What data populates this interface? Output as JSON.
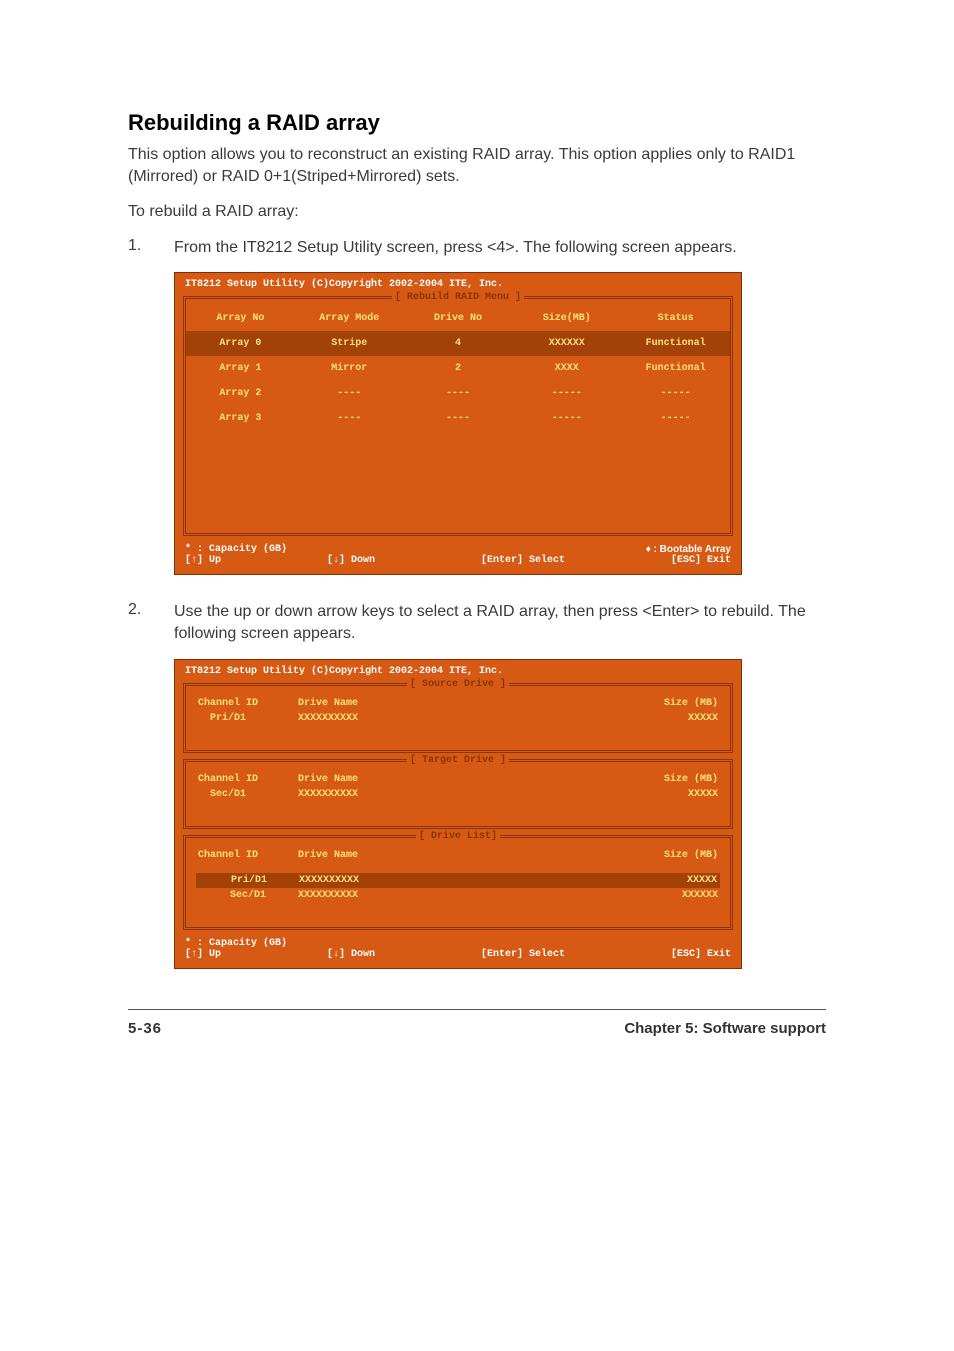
{
  "heading": "Rebuilding a RAID array",
  "intro": "This option allows you to reconstruct an existing RAID array. This option applies only to RAID1 (Mirrored) or RAID 0+1(Striped+Mirrored) sets.",
  "preList": "To rebuild a RAID array:",
  "steps": {
    "s1num": "1.",
    "s1text": "From the IT8212 Setup Utility screen, press <4>. The following screen appears.",
    "s2num": "2.",
    "s2text": "Use the up or down arrow keys to select a RAID array, then press <Enter> to rebuild. The following screen appears."
  },
  "bios1": {
    "title": "IT8212 Setup Utility (C)Copyright 2002-2004 ITE, Inc.",
    "menuLabel": "[ Rebuild RAID Menu ]",
    "headers": {
      "c1": "Array No",
      "c2": "Array Mode",
      "c3": "Drive No",
      "c4": "Size(MB)",
      "c5": "Status"
    },
    "rows": [
      {
        "c1": "Array 0",
        "c2": "Stripe",
        "c3": "4",
        "c4": "XXXXXX",
        "c5": "Functional",
        "selected": true
      },
      {
        "c1": "Array 1",
        "c2": "Mirror",
        "c3": "2",
        "c4": "XXXX",
        "c5": "Functional",
        "selected": false
      },
      {
        "c1": "Array 2",
        "c2": "----",
        "c3": "----",
        "c4": "-----",
        "c5": "-----",
        "selected": false
      },
      {
        "c1": "Array 3",
        "c2": "----",
        "c3": "----",
        "c4": "-----",
        "c5": "-----",
        "selected": false
      }
    ],
    "legend": {
      "cap": "* : Capacity (GB)",
      "boot": "♦ : Bootable Array",
      "up": "[↑] Up",
      "down": "[↓] Down",
      "select": "[Enter] Select",
      "exit": "[ESC] Exit"
    }
  },
  "bios2": {
    "title": "IT8212 Setup Utility (C)Copyright 2002-2004 ITE, Inc.",
    "source": {
      "label": "[ Source Drive ]",
      "hdr": {
        "ch": "Channel ID",
        "dn": "Drive Name",
        "sz": "Size (MB)"
      },
      "row": {
        "ch": "Pri/D1",
        "dn": "XXXXXXXXXX",
        "sz": "XXXXX"
      }
    },
    "target": {
      "label": "[ Target Drive ]",
      "hdr": {
        "ch": "Channel ID",
        "dn": "Drive Name",
        "sz": "Size (MB)"
      },
      "row": {
        "ch": "Sec/D1",
        "dn": "XXXXXXXXXX",
        "sz": "XXXXX"
      }
    },
    "list": {
      "label": "[ Drive List]",
      "hdr": {
        "ch": "Channel ID",
        "dn": "Drive Name",
        "sz": "Size (MB)"
      },
      "rows": [
        {
          "ch": "Pri/D1",
          "dn": "XXXXXXXXXX",
          "sz": "XXXXX",
          "selected": true
        },
        {
          "ch": "Sec/D1",
          "dn": "XXXXXXXXXX",
          "sz": "XXXXXX",
          "selected": false
        }
      ]
    },
    "legend": {
      "cap": "* : Capacity (GB)",
      "up": "[↑] Up",
      "down": "[↓] Down",
      "select": "[Enter] Select",
      "exit": "[ESC] Exit"
    }
  },
  "footer": {
    "page": "5-36",
    "chapter": "Chapter 5: Software support"
  }
}
